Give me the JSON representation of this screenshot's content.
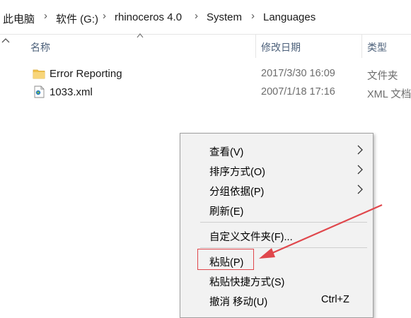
{
  "breadcrumb": {
    "items": [
      "此电脑",
      "软件 (G:)",
      "rhinoceros 4.0",
      "System",
      "Languages"
    ],
    "separator_icon": "chevron-right-icon"
  },
  "columns": {
    "name": "名称",
    "modified": "修改日期",
    "type": "类型"
  },
  "files": [
    {
      "name": "Error Reporting",
      "modified": "2017/3/30 16:09",
      "type": "文件夹",
      "icon": "folder-icon"
    },
    {
      "name": "1033.xml",
      "modified": "2007/1/18 17:16",
      "type": "XML 文档",
      "icon": "xml-file-icon"
    }
  ],
  "context_menu": {
    "items": [
      {
        "label": "查看(V)",
        "submenu": true
      },
      {
        "label": "排序方式(O)",
        "submenu": true
      },
      {
        "label": "分组依据(P)",
        "submenu": true
      },
      {
        "label": "刷新(E)",
        "submenu": false
      },
      {
        "label": "自定义文件夹(F)...",
        "submenu": false
      },
      {
        "label": "粘贴(P)",
        "submenu": false,
        "highlighted": true
      },
      {
        "label": "粘贴快捷方式(S)",
        "submenu": false
      },
      {
        "label": "撤消 移动(U)",
        "submenu": false,
        "shortcut": "Ctrl+Z"
      }
    ]
  },
  "colors": {
    "highlight_box": "#e0474c",
    "annotation_arrow": "#e0474c",
    "folder": "#f0c14b"
  }
}
